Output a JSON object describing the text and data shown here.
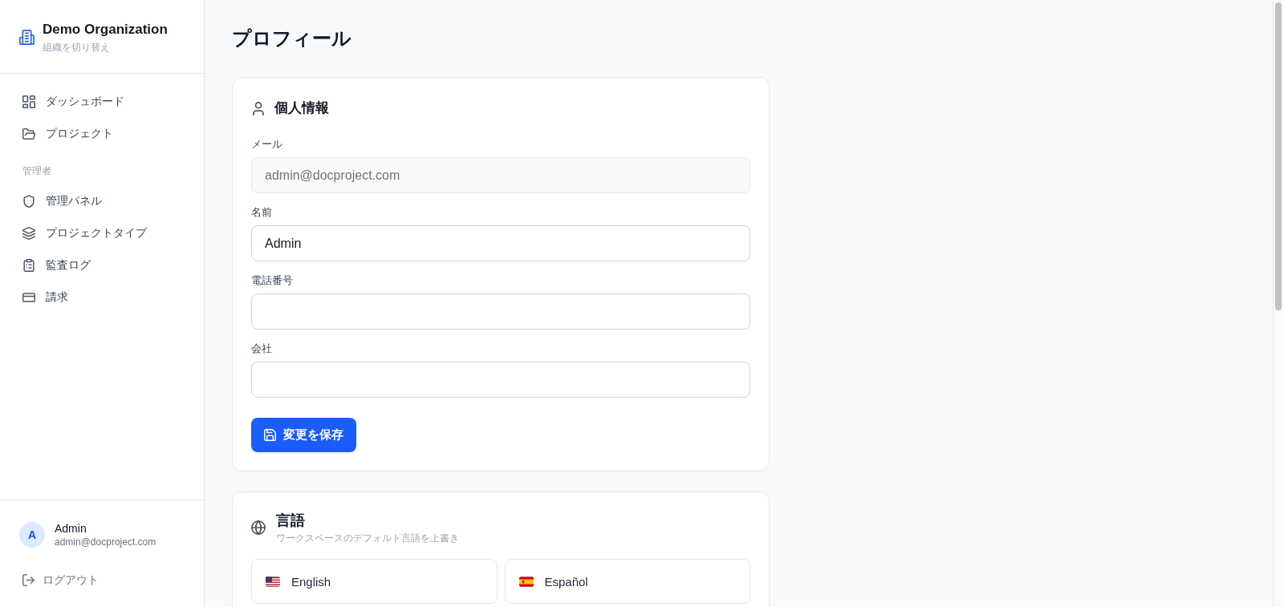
{
  "sidebar": {
    "organization": {
      "name": "Demo Organization",
      "switch_label": "組織を切り替え"
    },
    "nav": {
      "items": [
        {
          "label": "ダッシュボード",
          "selected": false
        },
        {
          "label": "プロジェクト",
          "selected": false
        }
      ],
      "sections": [
        {
          "heading": "管理者",
          "items": [
            {
              "label": "管理パネル",
              "selected": false
            },
            {
              "label": "プロジェクトタイプ",
              "selected": false
            },
            {
              "label": "監査ログ",
              "selected": false
            },
            {
              "label": "請求",
              "selected": false
            }
          ]
        }
      ]
    },
    "user": {
      "initial": "A",
      "name": "Admin",
      "email": "admin@docproject.com"
    },
    "logout": "ログアウト"
  },
  "page_title": "プロフィール",
  "personal_info": {
    "title": "個人情報",
    "fields": [
      {
        "label": "メール",
        "value": "admin@docproject.com",
        "disabled": true
      },
      {
        "label": "名前",
        "value": "Admin",
        "disabled": false
      },
      {
        "label": "電話番号",
        "disabled": false
      },
      {
        "label": "会社",
        "disabled": false
      }
    ],
    "save_button": "変更を保存"
  },
  "language": {
    "title": "言語",
    "subtitle": "ワークスペースのデフォルト言語を上書き",
    "options": [
      {
        "label": "English",
        "selected": false
      },
      {
        "label": "Español",
        "selected": false
      }
    ]
  }
}
